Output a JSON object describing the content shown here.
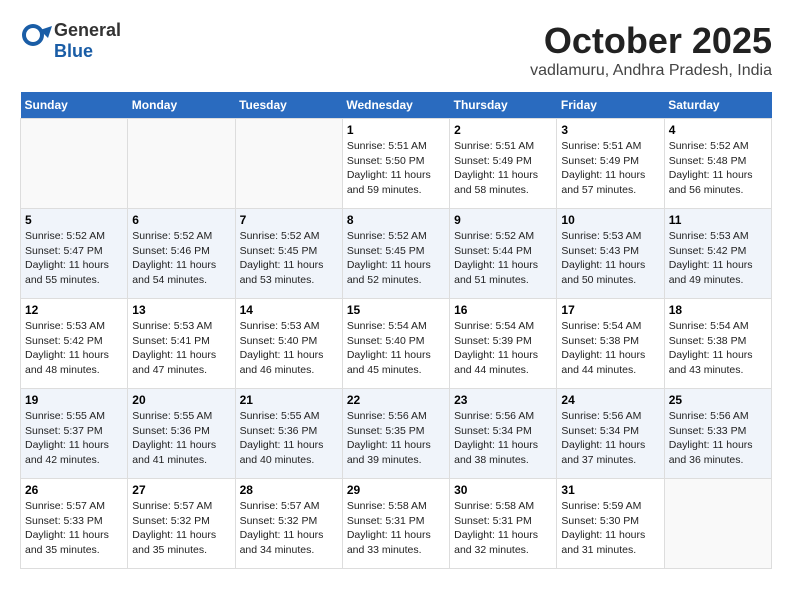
{
  "logo": {
    "general": "General",
    "blue": "Blue"
  },
  "header": {
    "title": "October 2025",
    "subtitle": "vadlamuru, Andhra Pradesh, India"
  },
  "days_of_week": [
    "Sunday",
    "Monday",
    "Tuesday",
    "Wednesday",
    "Thursday",
    "Friday",
    "Saturday"
  ],
  "weeks": [
    [
      {
        "day": "",
        "info": ""
      },
      {
        "day": "",
        "info": ""
      },
      {
        "day": "",
        "info": ""
      },
      {
        "day": "1",
        "info": "Sunrise: 5:51 AM\nSunset: 5:50 PM\nDaylight: 11 hours\nand 59 minutes."
      },
      {
        "day": "2",
        "info": "Sunrise: 5:51 AM\nSunset: 5:49 PM\nDaylight: 11 hours\nand 58 minutes."
      },
      {
        "day": "3",
        "info": "Sunrise: 5:51 AM\nSunset: 5:49 PM\nDaylight: 11 hours\nand 57 minutes."
      },
      {
        "day": "4",
        "info": "Sunrise: 5:52 AM\nSunset: 5:48 PM\nDaylight: 11 hours\nand 56 minutes."
      }
    ],
    [
      {
        "day": "5",
        "info": "Sunrise: 5:52 AM\nSunset: 5:47 PM\nDaylight: 11 hours\nand 55 minutes."
      },
      {
        "day": "6",
        "info": "Sunrise: 5:52 AM\nSunset: 5:46 PM\nDaylight: 11 hours\nand 54 minutes."
      },
      {
        "day": "7",
        "info": "Sunrise: 5:52 AM\nSunset: 5:45 PM\nDaylight: 11 hours\nand 53 minutes."
      },
      {
        "day": "8",
        "info": "Sunrise: 5:52 AM\nSunset: 5:45 PM\nDaylight: 11 hours\nand 52 minutes."
      },
      {
        "day": "9",
        "info": "Sunrise: 5:52 AM\nSunset: 5:44 PM\nDaylight: 11 hours\nand 51 minutes."
      },
      {
        "day": "10",
        "info": "Sunrise: 5:53 AM\nSunset: 5:43 PM\nDaylight: 11 hours\nand 50 minutes."
      },
      {
        "day": "11",
        "info": "Sunrise: 5:53 AM\nSunset: 5:42 PM\nDaylight: 11 hours\nand 49 minutes."
      }
    ],
    [
      {
        "day": "12",
        "info": "Sunrise: 5:53 AM\nSunset: 5:42 PM\nDaylight: 11 hours\nand 48 minutes."
      },
      {
        "day": "13",
        "info": "Sunrise: 5:53 AM\nSunset: 5:41 PM\nDaylight: 11 hours\nand 47 minutes."
      },
      {
        "day": "14",
        "info": "Sunrise: 5:53 AM\nSunset: 5:40 PM\nDaylight: 11 hours\nand 46 minutes."
      },
      {
        "day": "15",
        "info": "Sunrise: 5:54 AM\nSunset: 5:40 PM\nDaylight: 11 hours\nand 45 minutes."
      },
      {
        "day": "16",
        "info": "Sunrise: 5:54 AM\nSunset: 5:39 PM\nDaylight: 11 hours\nand 44 minutes."
      },
      {
        "day": "17",
        "info": "Sunrise: 5:54 AM\nSunset: 5:38 PM\nDaylight: 11 hours\nand 44 minutes."
      },
      {
        "day": "18",
        "info": "Sunrise: 5:54 AM\nSunset: 5:38 PM\nDaylight: 11 hours\nand 43 minutes."
      }
    ],
    [
      {
        "day": "19",
        "info": "Sunrise: 5:55 AM\nSunset: 5:37 PM\nDaylight: 11 hours\nand 42 minutes."
      },
      {
        "day": "20",
        "info": "Sunrise: 5:55 AM\nSunset: 5:36 PM\nDaylight: 11 hours\nand 41 minutes."
      },
      {
        "day": "21",
        "info": "Sunrise: 5:55 AM\nSunset: 5:36 PM\nDaylight: 11 hours\nand 40 minutes."
      },
      {
        "day": "22",
        "info": "Sunrise: 5:56 AM\nSunset: 5:35 PM\nDaylight: 11 hours\nand 39 minutes."
      },
      {
        "day": "23",
        "info": "Sunrise: 5:56 AM\nSunset: 5:34 PM\nDaylight: 11 hours\nand 38 minutes."
      },
      {
        "day": "24",
        "info": "Sunrise: 5:56 AM\nSunset: 5:34 PM\nDaylight: 11 hours\nand 37 minutes."
      },
      {
        "day": "25",
        "info": "Sunrise: 5:56 AM\nSunset: 5:33 PM\nDaylight: 11 hours\nand 36 minutes."
      }
    ],
    [
      {
        "day": "26",
        "info": "Sunrise: 5:57 AM\nSunset: 5:33 PM\nDaylight: 11 hours\nand 35 minutes."
      },
      {
        "day": "27",
        "info": "Sunrise: 5:57 AM\nSunset: 5:32 PM\nDaylight: 11 hours\nand 35 minutes."
      },
      {
        "day": "28",
        "info": "Sunrise: 5:57 AM\nSunset: 5:32 PM\nDaylight: 11 hours\nand 34 minutes."
      },
      {
        "day": "29",
        "info": "Sunrise: 5:58 AM\nSunset: 5:31 PM\nDaylight: 11 hours\nand 33 minutes."
      },
      {
        "day": "30",
        "info": "Sunrise: 5:58 AM\nSunset: 5:31 PM\nDaylight: 11 hours\nand 32 minutes."
      },
      {
        "day": "31",
        "info": "Sunrise: 5:59 AM\nSunset: 5:30 PM\nDaylight: 11 hours\nand 31 minutes."
      },
      {
        "day": "",
        "info": ""
      }
    ]
  ]
}
